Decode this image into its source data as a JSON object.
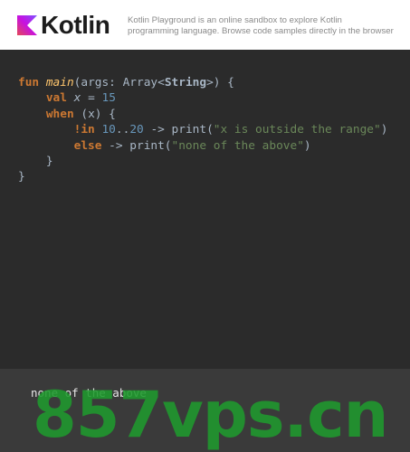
{
  "header": {
    "logo_text": "Kotlin",
    "tagline_line1": "Kotlin Playground is an online sandbox to explore Kotlin",
    "tagline_line2": "programming language. Browse code samples directly in the browser"
  },
  "editor": {
    "lines": [
      [
        {
          "t": "fun ",
          "c": "kw"
        },
        {
          "t": "main",
          "c": "fn"
        },
        {
          "t": "(args: Array<",
          "c": ""
        },
        {
          "t": "String",
          "c": "ty"
        },
        {
          "t": ">) {",
          "c": ""
        }
      ],
      [
        {
          "t": "    ",
          "c": ""
        },
        {
          "t": "val ",
          "c": "kw"
        },
        {
          "t": "x",
          "c": "it"
        },
        {
          "t": " = ",
          "c": ""
        },
        {
          "t": "15",
          "c": "num"
        }
      ],
      [
        {
          "t": "    ",
          "c": ""
        },
        {
          "t": "when",
          "c": "kw"
        },
        {
          "t": " (x) {",
          "c": ""
        }
      ],
      [
        {
          "t": "        ",
          "c": ""
        },
        {
          "t": "!in ",
          "c": "kw"
        },
        {
          "t": "10",
          "c": "num"
        },
        {
          "t": "..",
          "c": ""
        },
        {
          "t": "20",
          "c": "num"
        },
        {
          "t": " -> print(",
          "c": ""
        },
        {
          "t": "\"x is outside the range\"",
          "c": "str"
        },
        {
          "t": ")",
          "c": ""
        }
      ],
      [
        {
          "t": "        ",
          "c": ""
        },
        {
          "t": "else",
          "c": "kw"
        },
        {
          "t": " -> print(",
          "c": ""
        },
        {
          "t": "\"none of the above\"",
          "c": "str"
        },
        {
          "t": ")",
          "c": ""
        }
      ],
      [
        {
          "t": "    }",
          "c": ""
        }
      ],
      [
        {
          "t": "}",
          "c": ""
        }
      ]
    ]
  },
  "output": {
    "text": "none of the above"
  },
  "watermark": {
    "text": "857vps.cn"
  },
  "colors": {
    "keyword": "#cc7832",
    "function": "#ffc66d",
    "number": "#6897bb",
    "string": "#6a8759",
    "plain": "#a9b7c6",
    "editor_bg": "#2b2b2b",
    "output_bg": "#3a3a3a",
    "watermark": "#1f9a2e"
  }
}
